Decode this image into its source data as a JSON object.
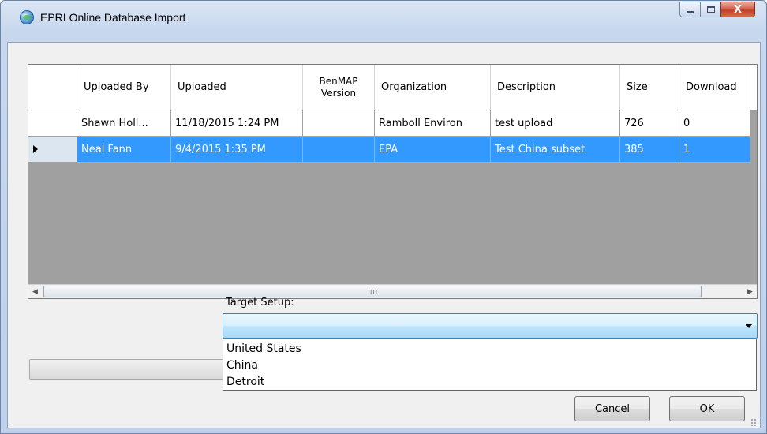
{
  "window": {
    "title": "EPRI Online Database Import",
    "controls": {
      "minimize": "minimize",
      "maximize": "maximize",
      "close": "X"
    }
  },
  "grid": {
    "columns": [
      {
        "label": "Uploaded By"
      },
      {
        "label": "Uploaded"
      },
      {
        "label": "BenMAP Version"
      },
      {
        "label": "Organization"
      },
      {
        "label": "Description"
      },
      {
        "label": "Size"
      },
      {
        "label": "Download"
      }
    ],
    "rows": [
      {
        "uploaded_by": "Shawn Holl...",
        "uploaded": "11/18/2015 1:24 PM",
        "version": "",
        "organization": "Ramboll Environ",
        "description": "test upload",
        "size": "726",
        "downloads": "0",
        "selected": false
      },
      {
        "uploaded_by": "Neal Fann",
        "uploaded": "9/4/2015 1:35 PM",
        "version": "",
        "organization": "EPA",
        "description": "Test China subset",
        "size": "385",
        "downloads": "1",
        "selected": true
      }
    ],
    "scrollbar": {
      "grip": "III"
    }
  },
  "target_setup": {
    "label": "Target Setup:",
    "value": "",
    "options": [
      "United States",
      "China",
      "Detroit"
    ]
  },
  "buttons": {
    "cancel": "Cancel",
    "ok": "OK"
  }
}
